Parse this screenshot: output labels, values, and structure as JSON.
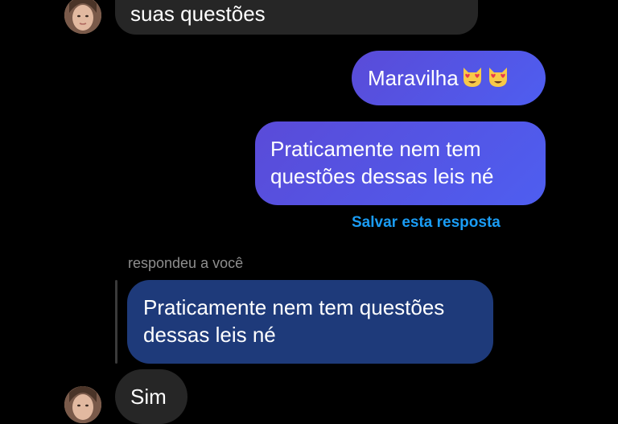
{
  "messages": {
    "incoming_top": {
      "text": "suas questões"
    },
    "outgoing_1": {
      "text": "Maravilha",
      "emoji": [
        "smiling-cat-heart-eyes-icon",
        "smiling-cat-heart-eyes-icon"
      ]
    },
    "outgoing_2": {
      "line1": "Praticamente nem tem",
      "line2": "questões dessas leis né"
    },
    "save_reply_label": "Salvar esta resposta",
    "reply_meta": "respondeu a você",
    "quoted": {
      "line1": "Praticamente nem tem questões",
      "line2": "dessas leis né"
    },
    "incoming_bottom": {
      "text": "Sim"
    }
  },
  "colors": {
    "incoming_bubble": "#262626",
    "outgoing_gradient_start": "#5a4bd8",
    "outgoing_gradient_end": "#4e5ef0",
    "quoted_bubble": "#1e3a7a",
    "link": "#1a9cf4",
    "meta_text": "#8e8e8e"
  }
}
